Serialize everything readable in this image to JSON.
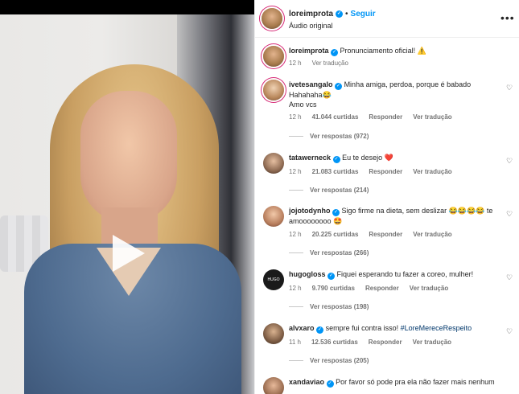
{
  "post": {
    "username": "loreimprota",
    "separator": "•",
    "follow": "Seguir",
    "audio": "Áudio original",
    "more": "•••",
    "caption": "Pronunciamento oficial!",
    "caption_emoji": "⚠️",
    "time": "12 h",
    "translate": "Ver tradução"
  },
  "comments": [
    {
      "username": "ivetesangalo",
      "text": "Minha amiga, perdoa, porque é babado Hahahaha😂",
      "text2": "Amo vcs",
      "time": "12 h",
      "likes": "41.044 curtidas",
      "reply": "Responder",
      "translate": "Ver tradução",
      "replies": "Ver respostas (972)"
    },
    {
      "username": "tatawerneck",
      "text": "Eu te desejo ❤️",
      "time": "12 h",
      "likes": "21.083 curtidas",
      "reply": "Responder",
      "translate": "Ver tradução",
      "replies": "Ver respostas (214)"
    },
    {
      "username": "jojotodynho",
      "text": "Sigo firme na dieta, sem deslizar 😂😂😂😂 te amoooooooo 🤩",
      "time": "12 h",
      "likes": "20.225 curtidas",
      "reply": "Responder",
      "translate": "Ver tradução",
      "replies": "Ver respostas (266)"
    },
    {
      "username": "hugogloss",
      "text": "Fiquei esperando tu fazer a coreo, mulher!",
      "time": "12 h",
      "likes": "9.790 curtidas",
      "reply": "Responder",
      "translate": "Ver tradução",
      "replies": "Ver respostas (198)"
    },
    {
      "username": "alvxaro",
      "text": "sempre fui contra isso! #LoreMereceRespeito",
      "time": "11 h",
      "likes": "12.536 curtidas",
      "reply": "Responder",
      "translate": "Ver tradução",
      "replies": "Ver respostas (205)"
    },
    {
      "username": "xandaviao",
      "text": "Por favor só pode pra ela não fazer mais nenhum"
    }
  ],
  "icons": {
    "heart": "♡",
    "play": "play-icon",
    "verified": "✓"
  },
  "colors": {
    "link": "#0095f6",
    "verified": "#0095f6",
    "muted": "#737373",
    "hashtag": "#00376b"
  }
}
